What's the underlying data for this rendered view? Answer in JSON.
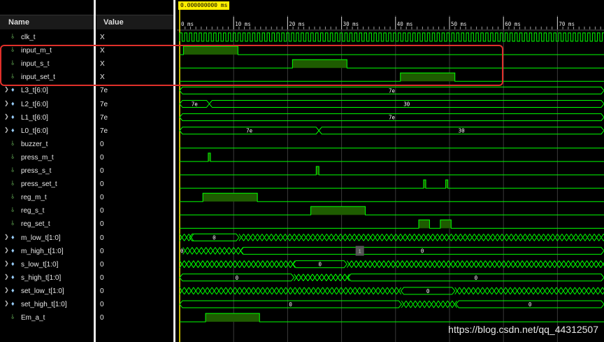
{
  "header": {
    "name": "Name",
    "value": "Value"
  },
  "cursor_time": "0.000000000 ms",
  "time_ticks": [
    "0 ms",
    "10 ms",
    "20 ms",
    "30 ms",
    "40 ms",
    "50 ms",
    "60 ms",
    "70 ms"
  ],
  "watermark": "https://blog.csdn.net/qq_44312507",
  "marker_label": "1",
  "colors": {
    "wave": "#00ff00",
    "fill": "#1e5c00",
    "highlight": "#e0302a",
    "cursor": "#ffee00"
  },
  "signals": [
    {
      "name": "clk_t",
      "value": "X",
      "kind": "bit",
      "icon": "bit-signal-icon"
    },
    {
      "name": "input_m_t",
      "value": "X",
      "kind": "bit",
      "icon": "bit-signal-icon"
    },
    {
      "name": "input_s_t",
      "value": "X",
      "kind": "bit",
      "icon": "bit-signal-icon"
    },
    {
      "name": "input_set_t",
      "value": "X",
      "kind": "bit",
      "icon": "bit-signal-icon"
    },
    {
      "name": "L3_t[6:0]",
      "value": "7e",
      "kind": "bus",
      "icon": "bus-signal-icon",
      "segments": [
        "7e"
      ]
    },
    {
      "name": "L2_t[6:0]",
      "value": "7e",
      "kind": "bus",
      "icon": "bus-signal-icon",
      "segments": [
        "7e",
        "30"
      ]
    },
    {
      "name": "L1_t[6:0]",
      "value": "7e",
      "kind": "bus",
      "icon": "bus-signal-icon",
      "segments": [
        "7e"
      ]
    },
    {
      "name": "L0_t[6:0]",
      "value": "7e",
      "kind": "bus",
      "icon": "bus-signal-icon",
      "segments": [
        "7e",
        "30"
      ]
    },
    {
      "name": "buzzer_t",
      "value": "0",
      "kind": "bit",
      "icon": "bit-signal-icon"
    },
    {
      "name": "press_m_t",
      "value": "0",
      "kind": "bit",
      "icon": "bit-signal-icon"
    },
    {
      "name": "press_s_t",
      "value": "0",
      "kind": "bit",
      "icon": "bit-signal-icon"
    },
    {
      "name": "press_set_t",
      "value": "0",
      "kind": "bit",
      "icon": "bit-signal-icon"
    },
    {
      "name": "reg_m_t",
      "value": "0",
      "kind": "bit",
      "icon": "bit-signal-icon"
    },
    {
      "name": "reg_s_t",
      "value": "0",
      "kind": "bit",
      "icon": "bit-signal-icon"
    },
    {
      "name": "reg_set_t",
      "value": "0",
      "kind": "bit",
      "icon": "bit-signal-icon"
    },
    {
      "name": "m_low_t[1:0]",
      "value": "0",
      "kind": "bus",
      "icon": "bus-signal-icon",
      "segments": [
        "0"
      ]
    },
    {
      "name": "m_high_t[1:0]",
      "value": "0",
      "kind": "bus",
      "icon": "bus-signal-icon",
      "segments": [
        "0",
        "0"
      ]
    },
    {
      "name": "s_low_t[1:0]",
      "value": "0",
      "kind": "bus",
      "icon": "bus-signal-icon",
      "segments": [
        "0"
      ]
    },
    {
      "name": "s_high_t[1:0]",
      "value": "0",
      "kind": "bus",
      "icon": "bus-signal-icon",
      "segments": [
        "0",
        "0"
      ]
    },
    {
      "name": "set_low_t[1:0]",
      "value": "0",
      "kind": "bus",
      "icon": "bus-signal-icon",
      "segments": [
        "0",
        "0"
      ]
    },
    {
      "name": "set_high_t[1:0]",
      "value": "0",
      "kind": "bus",
      "icon": "bus-signal-icon",
      "segments": [
        "0",
        "0"
      ]
    },
    {
      "name": "Em_a_t",
      "value": "0",
      "kind": "bit",
      "icon": "bit-signal-icon"
    }
  ]
}
